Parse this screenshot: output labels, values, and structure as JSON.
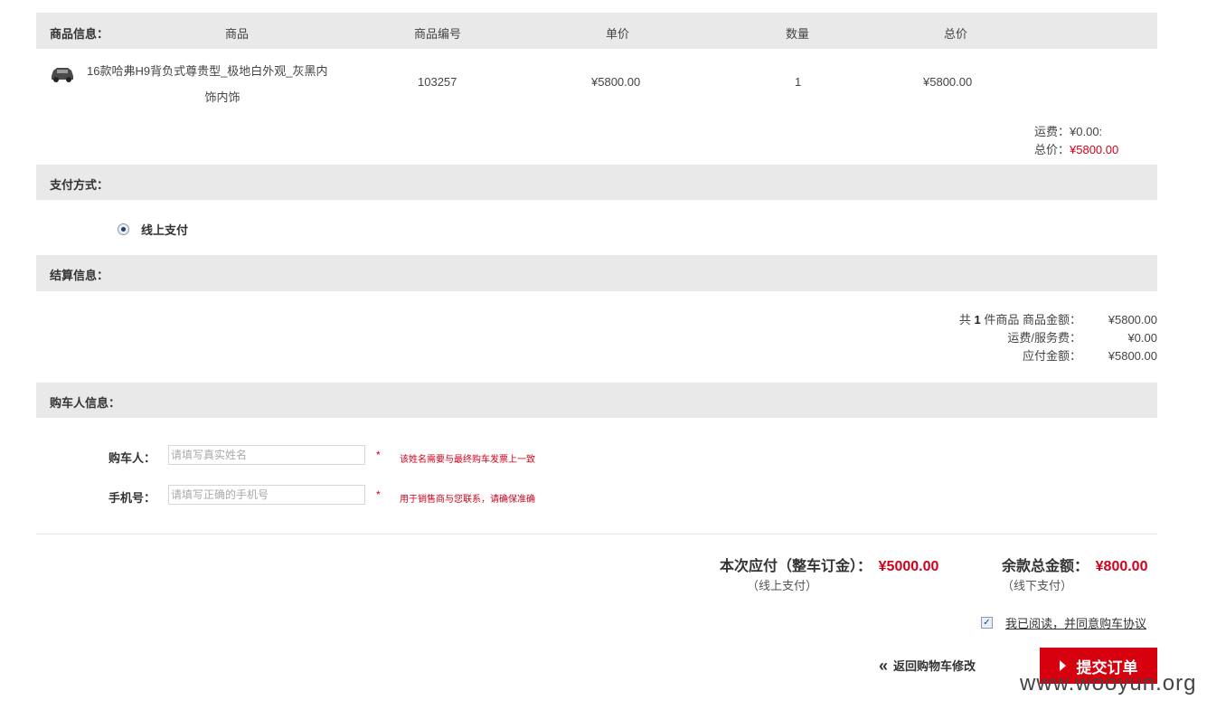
{
  "header": {
    "label": "商品信息：",
    "col_product": "商品",
    "col_code": "商品编号",
    "col_price": "单价",
    "col_qty": "数量",
    "col_total": "总价"
  },
  "product": {
    "name_line1": "16款哈弗H9背负式尊贵型_极地白外观_灰黑内",
    "name_line2": "饰内饰",
    "code": "103257",
    "price": "¥5800.00",
    "qty": "1",
    "total": "¥5800.00",
    "image_icon": "car-thumbnail"
  },
  "summary": {
    "shipping_label": "运费：",
    "shipping_value": "¥0.00:",
    "total_label": "总价：",
    "total_value": "¥5800.00"
  },
  "payment": {
    "title": "支付方式：",
    "option_label": "线上支付"
  },
  "settlement": {
    "title": "结算信息：",
    "prefix": "共",
    "count": "1",
    "suffix": "件商品 商品金额：",
    "goods_amount": "¥5800.00",
    "fee_label": "运费/服务费：",
    "fee_value": "¥0.00",
    "payable_label": "应付金额：",
    "payable_value": "¥5800.00"
  },
  "buyer": {
    "title": "购车人信息：",
    "name_label": "购车人：",
    "name_placeholder": "请填写真实姓名",
    "name_hint": "该姓名需要与最终购车发票上一致",
    "phone_label": "手机号：",
    "phone_placeholder": "请填写正确的手机号",
    "phone_hint": "用于销售商与您联系，请确保准确",
    "required_mark": "*"
  },
  "totals": {
    "deposit_label": "本次应付（整车订金）：",
    "deposit_value": "¥5000.00",
    "deposit_note": "（线上支付）",
    "balance_label": "余款总金额：",
    "balance_value": "¥800.00",
    "balance_note": "（线下支付）"
  },
  "agreement": {
    "label": "我已阅读，并同意购车协议",
    "checked": true
  },
  "actions": {
    "back_label": "返回购物车修改",
    "submit_label": "提交订单"
  },
  "watermark": "www.wooyun.org",
  "colors": {
    "accent": "#d6000f",
    "bar_bg": "#e9e9e9"
  }
}
